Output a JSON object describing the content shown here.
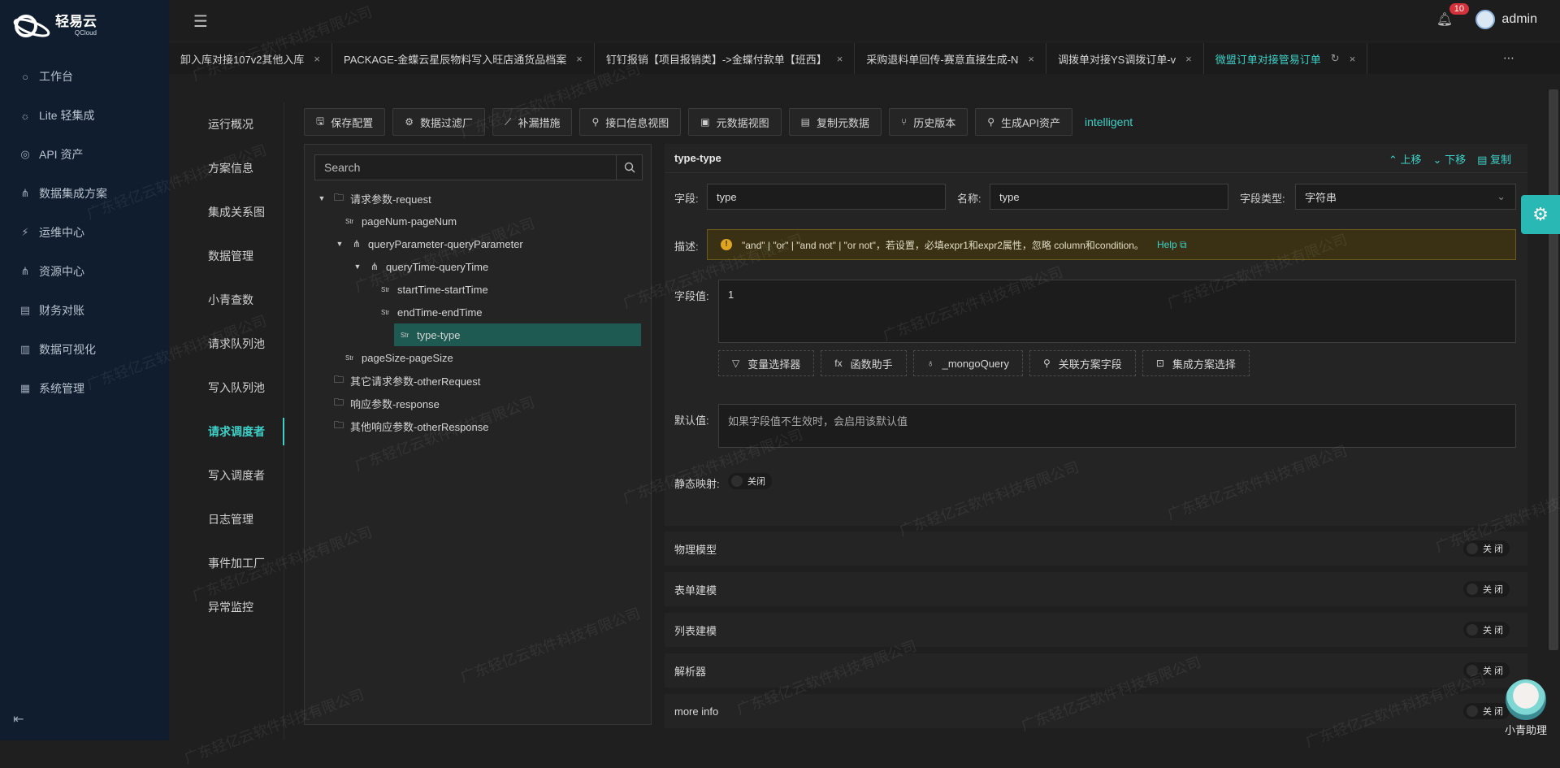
{
  "brand": {
    "name_cn": "轻易云",
    "name_en": "QCloud"
  },
  "nav": [
    {
      "icon": "○",
      "label": "工作台"
    },
    {
      "icon": "☼",
      "label": "Lite 轻集成"
    },
    {
      "icon": "◎",
      "label": "API 资产"
    },
    {
      "icon": "⋔",
      "label": "数据集成方案"
    },
    {
      "icon": "⚡",
      "label": "运维中心"
    },
    {
      "icon": "⋔",
      "label": "资源中心"
    },
    {
      "icon": "▤",
      "label": "财务对账"
    },
    {
      "icon": "▥",
      "label": "数据可视化"
    },
    {
      "icon": "▦",
      "label": "系统管理"
    }
  ],
  "header": {
    "notifications": "10",
    "user": "admin"
  },
  "tabs": [
    {
      "label": "卸入库对接107v2其他入库",
      "active": false
    },
    {
      "label": "PACKAGE-金蝶云星辰物料写入旺店通货品档案",
      "active": false
    },
    {
      "label": "钉钉报销【项目报销类】->金蝶付款单【班西】",
      "active": false
    },
    {
      "label": "采购退料单回传-赛意直接生成-N",
      "active": false
    },
    {
      "label": "调拨单对接YS调拨订单-v",
      "active": false
    },
    {
      "label": "微盟订单对接管易订单",
      "active": true
    }
  ],
  "subnav": [
    {
      "label": "运行概况",
      "active": false
    },
    {
      "label": "方案信息",
      "active": false
    },
    {
      "label": "集成关系图",
      "active": false
    },
    {
      "label": "数据管理",
      "active": false
    },
    {
      "label": "小青查数",
      "active": false
    },
    {
      "label": "请求队列池",
      "active": false
    },
    {
      "label": "写入队列池",
      "active": false
    },
    {
      "label": "请求调度者",
      "active": true
    },
    {
      "label": "写入调度者",
      "active": false
    },
    {
      "label": "日志管理",
      "active": false
    },
    {
      "label": "事件加工厂",
      "active": false
    },
    {
      "label": "异常监控",
      "active": false
    }
  ],
  "toolbar": {
    "buttons": [
      {
        "icon": "🖫",
        "label": "保存配置"
      },
      {
        "icon": "⚙",
        "label": "数据过滤厂"
      },
      {
        "icon": "⟋",
        "label": "补漏措施"
      },
      {
        "icon": "⚲",
        "label": "接口信息视图"
      },
      {
        "icon": "▣",
        "label": "元数据视图"
      },
      {
        "icon": "▤",
        "label": "复制元数据"
      },
      {
        "icon": "⑂",
        "label": "历史版本"
      },
      {
        "icon": "⚲",
        "label": "生成API资产"
      }
    ],
    "intelligent": "intelligent"
  },
  "tree": {
    "search_placeholder": "Search",
    "rows": [
      {
        "indent": 0,
        "arrow": "▼",
        "type": "folder",
        "label": "请求参数-request"
      },
      {
        "indent": 1,
        "arrow": "",
        "type": "str",
        "label": "pageNum-pageNum"
      },
      {
        "indent": 1,
        "arrow": "▼",
        "type": "node",
        "label": "queryParameter-queryParameter"
      },
      {
        "indent": 2,
        "arrow": "▼",
        "type": "node",
        "label": "queryTime-queryTime"
      },
      {
        "indent": 3,
        "arrow": "",
        "type": "str",
        "label": "startTime-startTime"
      },
      {
        "indent": 3,
        "arrow": "",
        "type": "str",
        "label": "endTime-endTime"
      },
      {
        "indent": 3,
        "arrow": "",
        "type": "str",
        "label": "type-type",
        "selected": true
      },
      {
        "indent": 1,
        "arrow": "",
        "type": "str",
        "label": "pageSize-pageSize"
      },
      {
        "indent": 0,
        "arrow": "",
        "type": "folder",
        "label": "其它请求参数-otherRequest"
      },
      {
        "indent": 0,
        "arrow": "",
        "type": "folder",
        "label": "响应参数-response"
      },
      {
        "indent": 0,
        "arrow": "",
        "type": "folder",
        "label": "其他响应参数-otherResponse"
      }
    ]
  },
  "detail": {
    "title": "type-type",
    "actions": {
      "up": "上移",
      "down": "下移",
      "copy": "复制"
    },
    "field_label": "字段:",
    "field_value": "type",
    "name_label": "名称:",
    "name_value": "type",
    "type_label": "字段类型:",
    "type_value": "字符串",
    "desc_label": "描述:",
    "desc_text": "\"and\" | \"or\" | \"and not\" | \"or not\"，若设置，必填expr1和expr2属性，忽略 column和condition。",
    "help": "Help",
    "value_label": "字段值:",
    "value_text": "1",
    "helpers": [
      {
        "icon": "▽",
        "label": "变量选择器"
      },
      {
        "icon": "fx",
        "label": "函数助手"
      },
      {
        "icon": "♁",
        "label": "_mongoQuery"
      },
      {
        "icon": "⚲",
        "label": "关联方案字段"
      },
      {
        "icon": "⊡",
        "label": "集成方案选择"
      }
    ],
    "default_label": "默认值:",
    "default_placeholder": "如果字段值不生效时，会启用该默认值",
    "static_label": "静态映射:",
    "switch_off": "关闭"
  },
  "sections": [
    {
      "label": "物理模型",
      "switch": "关 闭"
    },
    {
      "label": "表单建模",
      "switch": "关 闭"
    },
    {
      "label": "列表建模",
      "switch": "关 闭"
    },
    {
      "label": "解析器",
      "switch": "关 闭"
    },
    {
      "label": "more info",
      "switch": "关 闭"
    }
  ],
  "assistant": {
    "label": "小青助理"
  },
  "watermark": "广东轻亿云软件科技有限公司",
  "colors": {
    "accent": "#3ed1c8",
    "sidebar": "#0f1d2e",
    "selected": "#1f5a52",
    "warn": "#e0a520"
  }
}
